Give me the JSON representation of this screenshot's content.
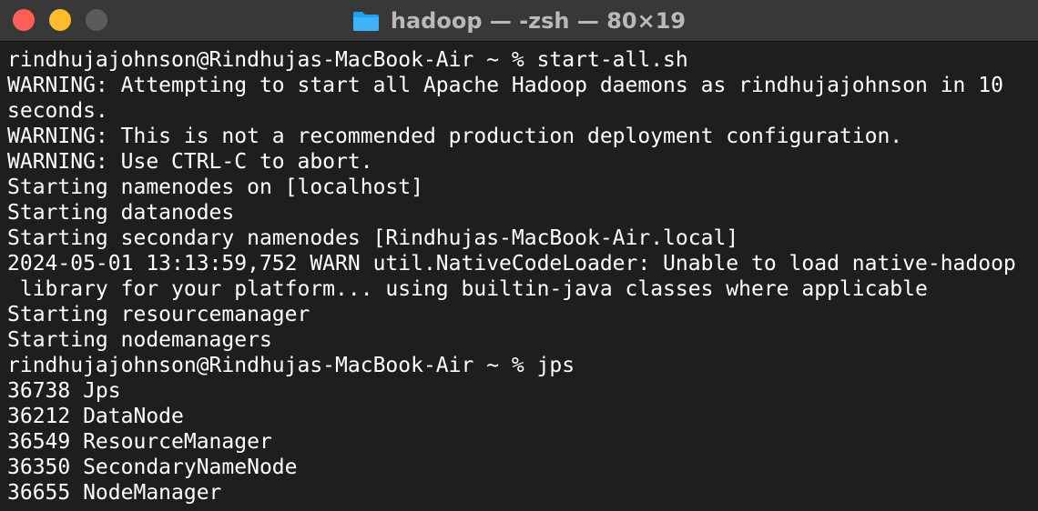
{
  "window": {
    "title": "hadoop — -zsh — 80×19",
    "icon": "folder-icon",
    "colors": {
      "close": "#ff5f57",
      "minimize": "#febc2e",
      "zoom": "#5b5b5b",
      "background": "#1e1e1e",
      "titlebar": "#383838",
      "text": "#ffffff"
    }
  },
  "terminal": {
    "lines": [
      "rindhujajohnson@Rindhujas-MacBook-Air ~ % start-all.sh",
      "WARNING: Attempting to start all Apache Hadoop daemons as rindhujajohnson in 10",
      "seconds.",
      "WARNING: This is not a recommended production deployment configuration.",
      "WARNING: Use CTRL-C to abort.",
      "Starting namenodes on [localhost]",
      "Starting datanodes",
      "Starting secondary namenodes [Rindhujas-MacBook-Air.local]",
      "2024-05-01 13:13:59,752 WARN util.NativeCodeLoader: Unable to load native-hadoop",
      " library for your platform... using builtin-java classes where applicable",
      "Starting resourcemanager",
      "Starting nodemanagers",
      "rindhujajohnson@Rindhujas-MacBook-Air ~ % jps",
      "36738 Jps",
      "36212 DataNode",
      "36549 ResourceManager",
      "36350 SecondaryNameNode",
      "36655 NodeManager"
    ]
  }
}
